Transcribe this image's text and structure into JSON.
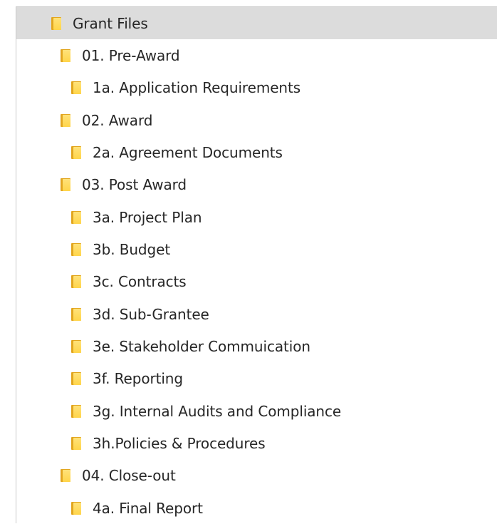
{
  "tree": {
    "root": {
      "label": "Grant Files",
      "icon": "folder-icon",
      "selected": true
    },
    "items": [
      {
        "label": "01. Pre-Award",
        "icon": "folder-icon"
      },
      {
        "label": "1a. Application Requirements",
        "icon": "folder-icon"
      },
      {
        "label": "02. Award",
        "icon": "folder-icon"
      },
      {
        "label": "2a. Agreement Documents",
        "icon": "folder-icon"
      },
      {
        "label": "03. Post Award",
        "icon": "folder-icon"
      },
      {
        "label": "3a. Project Plan",
        "icon": "folder-icon"
      },
      {
        "label": "3b. Budget",
        "icon": "folder-icon"
      },
      {
        "label": "3c. Contracts",
        "icon": "folder-icon"
      },
      {
        "label": "3d. Sub-Grantee",
        "icon": "folder-icon"
      },
      {
        "label": "3e. Stakeholder Commuication",
        "icon": "folder-icon"
      },
      {
        "label": "3f. Reporting",
        "icon": "folder-icon"
      },
      {
        "label": "3g. Internal Audits and Compliance",
        "icon": "folder-icon"
      },
      {
        "label": "3h.Policies & Procedures",
        "icon": "folder-icon"
      },
      {
        "label": "04. Close-out",
        "icon": "folder-icon"
      },
      {
        "label": "4a. Final Report",
        "icon": "folder-icon"
      }
    ]
  },
  "colors": {
    "selected_row": "#dcdcdc",
    "folder_body": "#ffd54a",
    "folder_back": "#e2a620",
    "border": "#c9c9c9"
  }
}
